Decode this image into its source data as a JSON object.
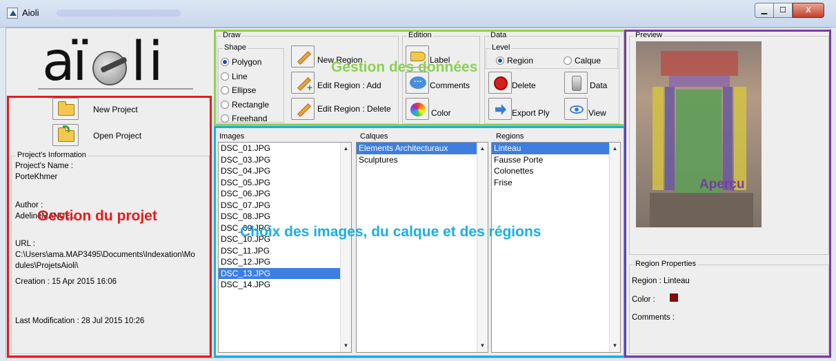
{
  "window": {
    "title": "Aioli",
    "min": "▁",
    "max": "☐",
    "close": "X"
  },
  "project": {
    "new_label": "New Project",
    "open_label": "Open Project",
    "info_title": "Project's Information",
    "name_label": "Project's Name :",
    "name_value": "PorteKhmer",
    "author_label": "Author :",
    "author_value": "AdelineMANUEL",
    "url_label": "URL :",
    "url_line1": "C:\\Users\\ama.MAP3495\\Documents\\Indexation\\Mo",
    "url_line2": "dules\\ProjetsAioli\\",
    "creation": "Creation : 15 Apr 2015 16:06",
    "last_mod": "Last Modification : 28 Jul 2015 10:26"
  },
  "draw": {
    "title": "Draw",
    "shape_title": "Shape",
    "shapes": [
      "Polygon",
      "Line",
      "Ellipse",
      "Rectangle",
      "Freehand"
    ],
    "new_region": "New Region",
    "edit_add": "Edit Region : Add",
    "edit_delete": "Edit Region : Delete"
  },
  "edition": {
    "title": "Edition",
    "label": "Label",
    "comments": "Comments",
    "color": "Color"
  },
  "data_panel": {
    "title": "Data",
    "level_title": "Level",
    "region": "Region",
    "calque": "Calque",
    "delete": "Delete",
    "data": "Data",
    "export": "Export Ply",
    "view": "View"
  },
  "images": {
    "title": "Images",
    "items": [
      "DSC_01.JPG",
      "DSC_03.JPG",
      "DSC_04.JPG",
      "DSC_05.JPG",
      "DSC_06.JPG",
      "DSC_07.JPG",
      "DSC_08.JPG",
      "DSC_09.JPG",
      "DSC_10.JPG",
      "DSC_11.JPG",
      "DSC_12.JPG",
      "DSC_13.JPG",
      "DSC_14.JPG"
    ],
    "selected": 11
  },
  "calques": {
    "title": "Calques",
    "items": [
      "Elements Architecturaux",
      "Sculptures"
    ],
    "selected": 0
  },
  "regions": {
    "title": "Regions",
    "items": [
      "Linteau",
      "Fausse Porte",
      "Colonettes",
      "Frise"
    ],
    "selected": 0
  },
  "preview": {
    "title": "Preview"
  },
  "region_props": {
    "title": "Region Properties",
    "region": "Region : Linteau",
    "color_label": "Color :",
    "swatch_color": "#7b0f0f",
    "comments": "Comments :"
  },
  "annotations": {
    "projet": "Gestion du projet",
    "donnees": "Gestion des données",
    "choix": "Choix des images, du calque et des régions",
    "apercu": "Aperçu"
  },
  "colors": {
    "red": "#e8191b",
    "green": "#8ed050",
    "blue": "#19aee6",
    "purple": "#7a3aa8"
  }
}
